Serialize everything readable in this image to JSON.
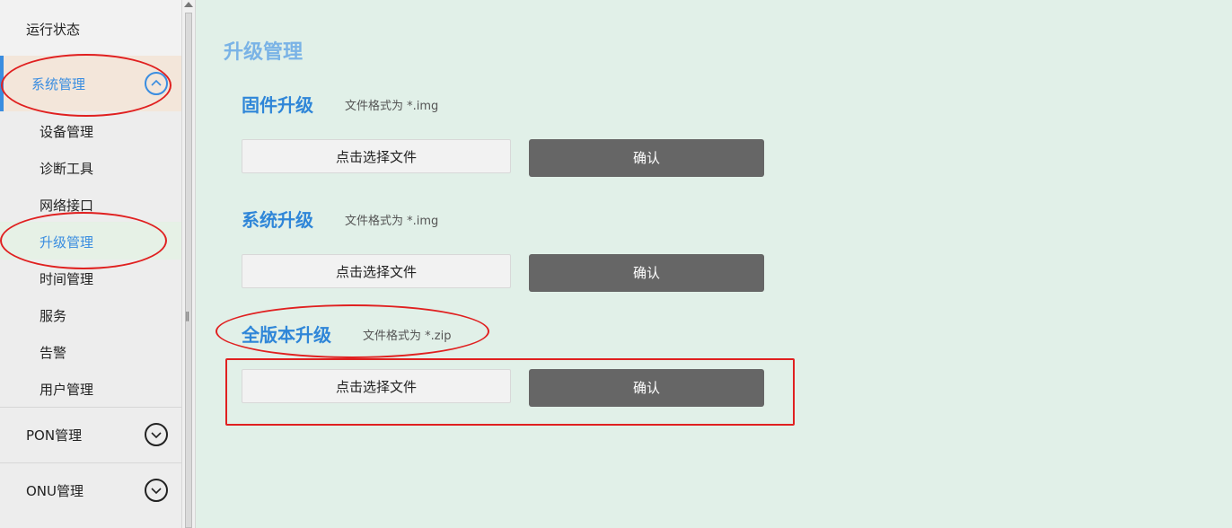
{
  "sidebar": {
    "top_item": "运行状态",
    "system_mgmt": "系统管理",
    "sub_items": [
      "设备管理",
      "诊断工具",
      "网络接口",
      "升级管理",
      "时间管理",
      "服务",
      "告警",
      "用户管理"
    ],
    "pon_mgmt": "PON管理",
    "onu_mgmt": "ONU管理"
  },
  "main": {
    "page_title": "升级管理",
    "sections": [
      {
        "title": "固件升级",
        "hint": "文件格式为 *.img",
        "file_button": "点击选择文件",
        "confirm_button": "确认"
      },
      {
        "title": "系统升级",
        "hint": "文件格式为 *.img",
        "file_button": "点击选择文件",
        "confirm_button": "确认"
      },
      {
        "title": "全版本升级",
        "hint": "文件格式为 *.zip",
        "file_button": "点击选择文件",
        "confirm_button": "确认"
      }
    ]
  },
  "icons": {
    "chevron_up": "chevron-up-icon",
    "chevron_down": "chevron-down-icon"
  },
  "colors": {
    "accent": "#3a8de0",
    "section_title": "#2f86d8",
    "page_title": "#7ab3e6",
    "confirm_bg": "#666666",
    "annotation": "#e02020",
    "main_bg": "#e1f0e8"
  }
}
